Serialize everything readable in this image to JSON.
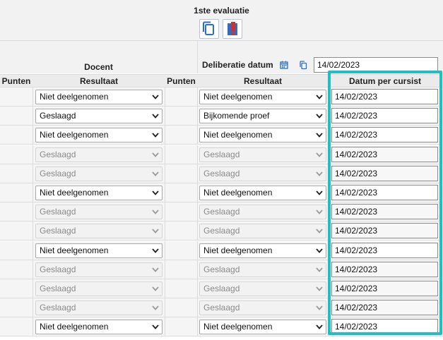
{
  "header": {
    "evaluation_title": "1ste evaluatie",
    "docent_label": "Docent",
    "deliberatie_label": "Deliberatie datum",
    "deliberatie_value": "14/02/2023",
    "copy_icon": "copy-icon",
    "pdf_icon": "pdf-export-icon",
    "calendar_icon": "calendar-icon",
    "small_copy_icon": "copy-icon"
  },
  "columns": {
    "punten_1": "Punten",
    "resultaat_1": "Resultaat",
    "punten_2": "Punten",
    "resultaat_2": "Resultaat",
    "datum": "Datum per cursist"
  },
  "rows": [
    {
      "docent": "Niet deelgenomen",
      "resultaat": "Niet deelgenomen",
      "datum": "14/02/2023",
      "enabled": true
    },
    {
      "docent": "Geslaagd",
      "resultaat": "Bijkomende proef",
      "datum": "14/02/2023",
      "enabled": true
    },
    {
      "docent": "Niet deelgenomen",
      "resultaat": "Niet deelgenomen",
      "datum": "14/02/2023",
      "enabled": true
    },
    {
      "docent": "Geslaagd",
      "resultaat": "Geslaagd",
      "datum": "14/02/2023",
      "enabled": false
    },
    {
      "docent": "Geslaagd",
      "resultaat": "Geslaagd",
      "datum": "14/02/2023",
      "enabled": false
    },
    {
      "docent": "Niet deelgenomen",
      "resultaat": "Niet deelgenomen",
      "datum": "14/02/2023",
      "enabled": true
    },
    {
      "docent": "Geslaagd",
      "resultaat": "Geslaagd",
      "datum": "14/02/2023",
      "enabled": false
    },
    {
      "docent": "Geslaagd",
      "resultaat": "Geslaagd",
      "datum": "14/02/2023",
      "enabled": false
    },
    {
      "docent": "Niet deelgenomen",
      "resultaat": "Niet deelgenomen",
      "datum": "14/02/2023",
      "enabled": true
    },
    {
      "docent": "Geslaagd",
      "resultaat": "Geslaagd",
      "datum": "14/02/2023",
      "enabled": false
    },
    {
      "docent": "Geslaagd",
      "resultaat": "Geslaagd",
      "datum": "14/02/2023",
      "enabled": false
    },
    {
      "docent": "Geslaagd",
      "resultaat": "Geslaagd",
      "datum": "14/02/2023",
      "enabled": false
    },
    {
      "docent": "Niet deelgenomen",
      "resultaat": "Niet deelgenomen",
      "datum": "14/02/2023",
      "enabled": true
    }
  ],
  "colors": {
    "highlight": "#1fbfc4",
    "icon_blue": "#2a6ec7",
    "icon_red": "#d0312d"
  }
}
